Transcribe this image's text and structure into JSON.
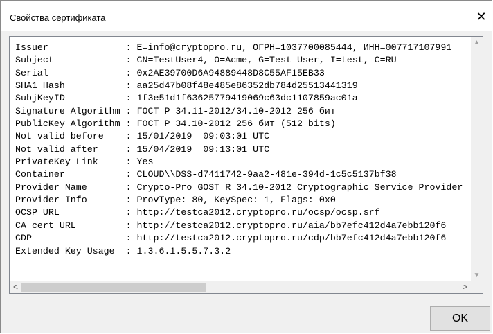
{
  "window": {
    "title": "Свойства сертификата",
    "close_label": "✕"
  },
  "certificate_lines": [
    "Issuer              : E=info@cryptopro.ru, ОГРН=1037700085444, ИНН=007717107991",
    "Subject             : CN=TestUser4, O=Acme, G=Test User, I=test, C=RU",
    "Serial              : 0x2AE39700D6A94889448D8C55AF15EB33",
    "SHA1 Hash           : aa25d47b08f48e485e86352db784d25513441319",
    "SubjKeyID           : 1f3e51d1f63625779419069c63dc1107859ac01a",
    "Signature Algorithm : ГОСТ Р 34.11-2012/34.10-2012 256 бит",
    "PublicKey Algorithm : ГОСТ Р 34.10-2012 256 бит (512 bits)",
    "Not valid before    : 15/01/2019  09:03:01 UTC",
    "Not valid after     : 15/04/2019  09:13:01 UTC",
    "PrivateKey Link     : Yes",
    "Container           : CLOUD\\\\DSS-d7411742-9aa2-481e-394d-1c5c5137bf38",
    "Provider Name       : Crypto-Pro GOST R 34.10-2012 Cryptographic Service Provider",
    "Provider Info       : ProvType: 80, KeySpec: 1, Flags: 0x0",
    "OCSP URL            : http://testca2012.cryptopro.ru/ocsp/ocsp.srf",
    "CA cert URL         : http://testca2012.cryptopro.ru/aia/bb7efc412d4a7ebb120f6",
    "CDP                 : http://testca2012.cryptopro.ru/cdp/bb7efc412d4a7ebb120f6",
    "Extended Key Usage  : 1.3.6.1.5.5.7.3.2"
  ],
  "scrollbar": {
    "up_icon": "chevron-up-icon",
    "down_icon": "chevron-down-icon",
    "left_icon": "chevron-left-icon",
    "right_icon": "chevron-right-icon",
    "horizontal_position": 0.0
  },
  "buttons": {
    "ok_label": "OK"
  }
}
